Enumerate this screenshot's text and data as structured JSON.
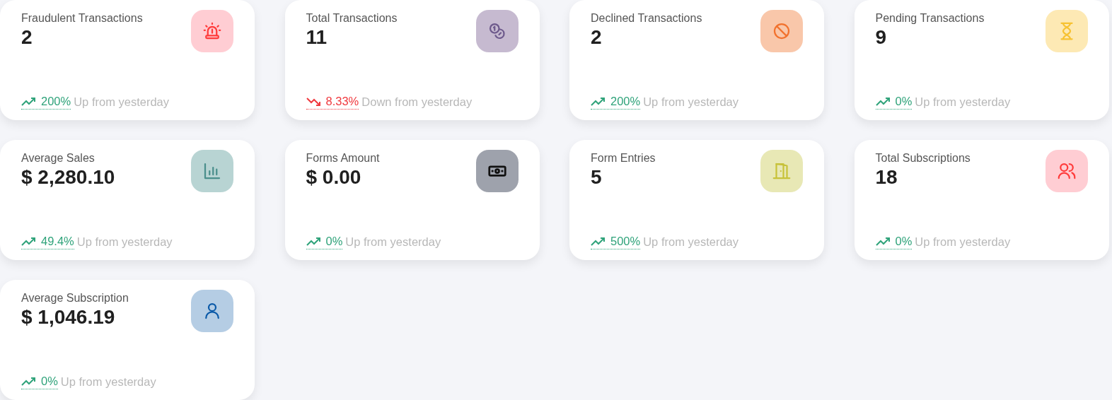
{
  "cards": [
    {
      "title": "Fraudulent Transactions",
      "value": "2",
      "kind": "siren",
      "color": "#ffcdd3",
      "trend": {
        "kind": "up",
        "percent": "200%",
        "text": "Up from yesterday"
      }
    },
    {
      "title": "Total Transactions",
      "value": "11",
      "kind": "coins",
      "color": "#c6bad0",
      "trend": {
        "kind": "down",
        "percent": "8.33%",
        "text": "Down from yesterday"
      }
    },
    {
      "title": "Declined Transactions",
      "value": "2",
      "kind": "ban",
      "color": "#f9c7aa",
      "trend": {
        "kind": "up",
        "percent": "200%",
        "text": "Up from yesterday"
      }
    },
    {
      "title": "Pending Transactions",
      "value": "9",
      "kind": "hourglass",
      "color": "#fde9b4",
      "trend": {
        "kind": "up",
        "percent": "0%",
        "text": "Up from yesterday"
      }
    },
    {
      "title": "Average Sales",
      "value": "$ 2,280.10",
      "kind": "chart",
      "color": "#b8d4d3",
      "trend": {
        "kind": "up",
        "percent": "49.4%",
        "text": "Up from yesterday"
      }
    },
    {
      "title": "Forms Amount",
      "value": "$ 0.00",
      "kind": "cash",
      "color": "#9ea2ac",
      "trend": {
        "kind": "up",
        "percent": "0%",
        "text": "Up from yesterday"
      }
    },
    {
      "title": "Form Entries",
      "value": "5",
      "kind": "door",
      "color": "#e8e8b5",
      "trend": {
        "kind": "up",
        "percent": "500%",
        "text": "Up from yesterday"
      }
    },
    {
      "title": "Total Subscriptions",
      "value": "18",
      "kind": "users",
      "color": "#ffcdd3",
      "trend": {
        "kind": "up",
        "percent": "0%",
        "text": "Up from yesterday"
      }
    },
    {
      "title": "Average Subscription",
      "value": "$ 1,046.19",
      "kind": "user",
      "color": "#b5cde4",
      "trend": {
        "kind": "up",
        "percent": "0%",
        "text": "Up from yesterday"
      }
    }
  ]
}
